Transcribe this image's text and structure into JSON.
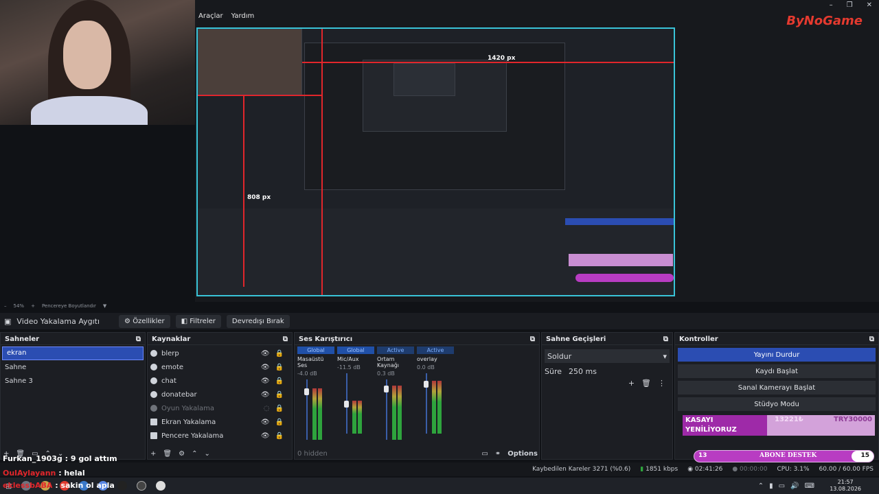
{
  "window": {
    "menu": [
      "Araçlar",
      "Yardım"
    ],
    "controls": [
      "–",
      "❐",
      "✕"
    ],
    "logo": "ByNoGame"
  },
  "preview": {
    "label_1420": "1420 px",
    "label_808": "808 px"
  },
  "zoombar": {
    "zoom": "54%",
    "fit": "Pencereye Boyutlandır"
  },
  "source_toolbar": {
    "source": "Video Yakalama Aygıtı",
    "properties": "Özellikler",
    "filters": "Filtreler",
    "deactivate": "Devredışı Bırak"
  },
  "scenes": {
    "title": "Sahneler",
    "items": [
      "ekran",
      "Sahne",
      "Sahne 3"
    ]
  },
  "sources": {
    "title": "Kaynaklar",
    "items": [
      "blerp",
      "emote",
      "chat",
      "donatebar",
      "Oyun Yakalama",
      "Ekran Yakalama",
      "Pencere Yakalama"
    ]
  },
  "mixer": {
    "title": "Ses Karıştırıcı",
    "hidden": "0 hidden",
    "options": "Options",
    "channels": [
      {
        "tag": "Global",
        "name": "Masaüstü Ses",
        "db": "-4.0 dB",
        "level": 0.85
      },
      {
        "tag": "Global",
        "name": "Mic/Aux",
        "db": "-11.5 dB",
        "level": 0.55
      },
      {
        "tag": "Active",
        "name": "Ortam Kaynağı",
        "db": "0.3 dB",
        "level": 0.9
      },
      {
        "tag": "Active",
        "name": "overlay",
        "db": "0.0 dB",
        "level": 0.88
      }
    ]
  },
  "transitions": {
    "title": "Sahne Geçişleri",
    "type": "Soldur",
    "duration_label": "Süre",
    "duration": "250 ms"
  },
  "controls": {
    "title": "Kontroller",
    "stop_stream": "Yayını Durdur",
    "record": "Kaydı Başlat",
    "virtual_cam": "Sanal Kamerayı Başlat",
    "studio": "Stüdyo Modu"
  },
  "kasa": {
    "text1": "KASAYI",
    "text2": "YENİLİYORUZ",
    "amount": "13221₺",
    "goal": "TRY30000",
    "progress": 0.44
  },
  "abone": {
    "left": "13",
    "label": "ABONE DESTEK",
    "right": "15"
  },
  "status": {
    "dropped": "Kaybedilen Kareler 3271 (%0.6)",
    "kbps": "1851 kbps",
    "live": "02:41:26",
    "rec": "00:00:00",
    "cpu": "CPU: 3.1%",
    "fps": "60.00 / 60.00 FPS"
  },
  "chat": {
    "line1": "Furkan_1903g : 9 gol attım",
    "line2_user": "OulAylayann",
    "line2_msg": " : helal",
    "line3_user": "eklessbABA",
    "line3_msg": " : sakin ol apla"
  },
  "clock": {
    "time": "21:57",
    "date": "13.08.2026"
  }
}
